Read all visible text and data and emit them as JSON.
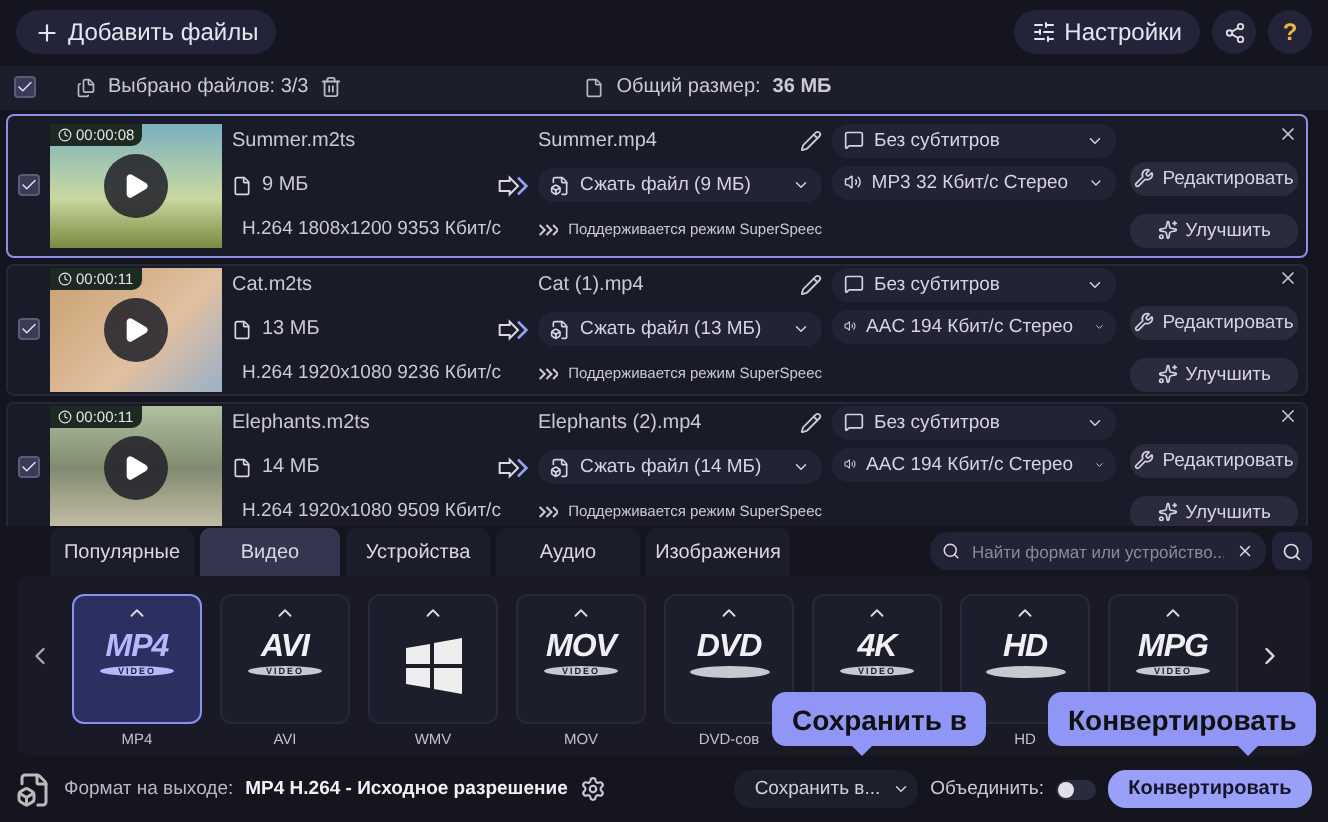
{
  "toolbar": {
    "add_button": "Добавить файлы",
    "settings_button": "Настройки",
    "help_button": "?"
  },
  "selection_bar": {
    "checked": true,
    "selected_label": "Выбрано файлов:",
    "selected_count": "3/3",
    "size_label": "Общий размер:",
    "size_value": "36 МБ"
  },
  "files": [
    {
      "selected": true,
      "checked": true,
      "duration": "00:00:08",
      "source_name": "Summer.m2ts",
      "source_size": "9 МБ",
      "source_info": "H.264 1808x1200 9353 Кбит/с",
      "output_name": "Summer.mp4",
      "compress": "Сжать файл (9 МБ)",
      "superspeed": "Поддерживается режим SuperSpeec",
      "subtitles": "Без субтитров",
      "audio": "MP3 32 Кбит/с Стерео",
      "edit_button": "Редактировать",
      "enhance_button": "Улучшить"
    },
    {
      "selected": false,
      "checked": true,
      "duration": "00:00:11",
      "source_name": "Cat.m2ts",
      "source_size": "13 МБ",
      "source_info": "H.264 1920x1080 9236 Кбит/с",
      "output_name": "Cat (1).mp4",
      "compress": "Сжать файл (13 МБ)",
      "superspeed": "Поддерживается режим SuperSpeec",
      "subtitles": "Без субтитров",
      "audio": "AAC 194 Кбит/с Стерео",
      "edit_button": "Редактировать",
      "enhance_button": "Улучшить"
    },
    {
      "selected": false,
      "checked": true,
      "duration": "00:00:11",
      "source_name": "Elephants.m2ts",
      "source_size": "14 МБ",
      "source_info": "H.264 1920x1080 9509 Кбит/с",
      "output_name": "Elephants (2).mp4",
      "compress": "Сжать файл (14 МБ)",
      "superspeed": "Поддерживается режим SuperSpeec",
      "subtitles": "Без субтитров",
      "audio": "AAC 194 Кбит/с Стерео",
      "edit_button": "Редактировать",
      "enhance_button": "Улучшить"
    }
  ],
  "format_tabs": [
    {
      "label": "Популярные",
      "selected": false
    },
    {
      "label": "Видео",
      "selected": true
    },
    {
      "label": "Устройства",
      "selected": false
    },
    {
      "label": "Аудио",
      "selected": false
    },
    {
      "label": "Изображения",
      "selected": false
    }
  ],
  "search": {
    "placeholder": "Найти формат или устройство..."
  },
  "formats": [
    {
      "kind": "text",
      "logo": "MP4",
      "badge": "VIDEO",
      "label": "MP4",
      "selected": true
    },
    {
      "kind": "text",
      "logo": "AVI",
      "badge": "VIDEO",
      "label": "AVI",
      "selected": false
    },
    {
      "kind": "windows",
      "label": "WMV",
      "selected": false
    },
    {
      "kind": "text",
      "logo": "MOV",
      "badge": "VIDEO",
      "label": "MOV",
      "selected": false
    },
    {
      "kind": "disc",
      "logo": "DVD",
      "label": "DVD-сов",
      "selected": false
    },
    {
      "kind": "text",
      "logo": "4K",
      "badge": "VIDEO",
      "selected": false
    },
    {
      "kind": "disc",
      "logo": "HD",
      "label": "HD",
      "selected": false
    },
    {
      "kind": "text",
      "logo": "MPG",
      "badge": "VIDEO",
      "selected": false
    }
  ],
  "bottom_bar": {
    "output_label": "Формат на выходе:",
    "output_value": "MP4 H.264 - Исходное разрешение",
    "save_button": "Сохранить в...",
    "merge_label": "Объединить:",
    "merge_on": false,
    "convert_button": "Конвертировать"
  },
  "tooltips": [
    {
      "text": "Сохранить в"
    },
    {
      "text": "Конвертировать"
    }
  ]
}
